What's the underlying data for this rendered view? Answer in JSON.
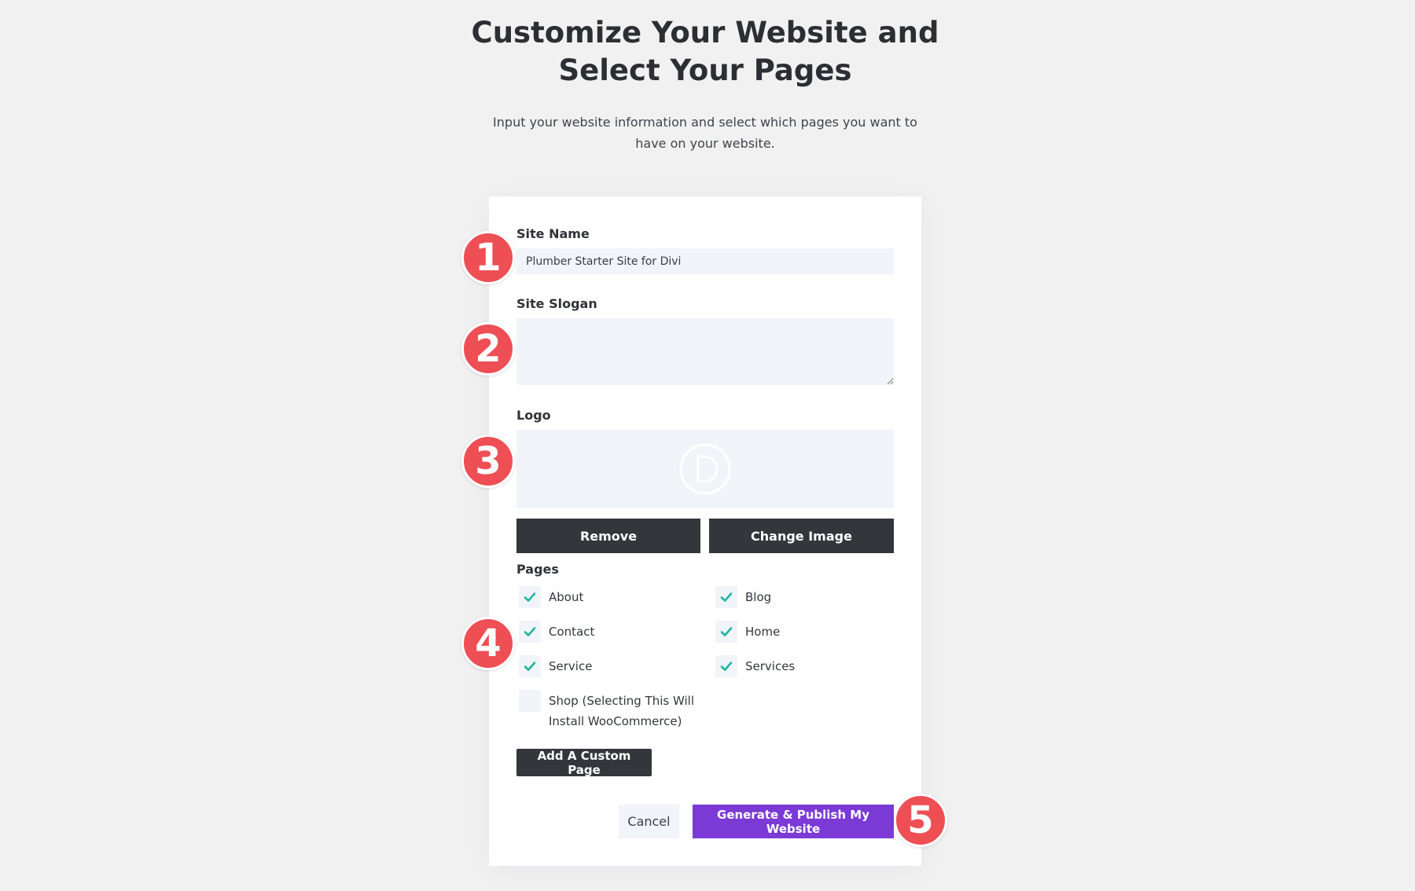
{
  "header": {
    "title_line1": "Customize Your Website and",
    "title_line2": "Select Your Pages",
    "subtitle": "Input your website information and select which pages you want to have on your website."
  },
  "form": {
    "site_name": {
      "label": "Site Name",
      "value": "Plumber Starter Site for Divi"
    },
    "site_slogan": {
      "label": "Site Slogan",
      "value": ""
    },
    "logo": {
      "label": "Logo",
      "icon": "divi-logo-icon",
      "remove_label": "Remove",
      "change_label": "Change Image"
    },
    "pages": {
      "label": "Pages",
      "options": [
        {
          "label": "About",
          "checked": true
        },
        {
          "label": "Blog",
          "checked": true
        },
        {
          "label": "Contact",
          "checked": true
        },
        {
          "label": "Home",
          "checked": true
        },
        {
          "label": "Service",
          "checked": true
        },
        {
          "label": "Services",
          "checked": true
        },
        {
          "label": "Shop (Selecting This Will Install WooCommerce)",
          "checked": false
        }
      ],
      "add_custom_label": "Add A Custom Page"
    },
    "actions": {
      "cancel_label": "Cancel",
      "generate_label": "Generate & Publish My Website"
    }
  },
  "steps": [
    "1",
    "2",
    "3",
    "4",
    "5"
  ],
  "colors": {
    "accent": "#7b39d6",
    "badge": "#ee4f55",
    "check": "#1fb5a6",
    "dark_button": "#33373c"
  }
}
